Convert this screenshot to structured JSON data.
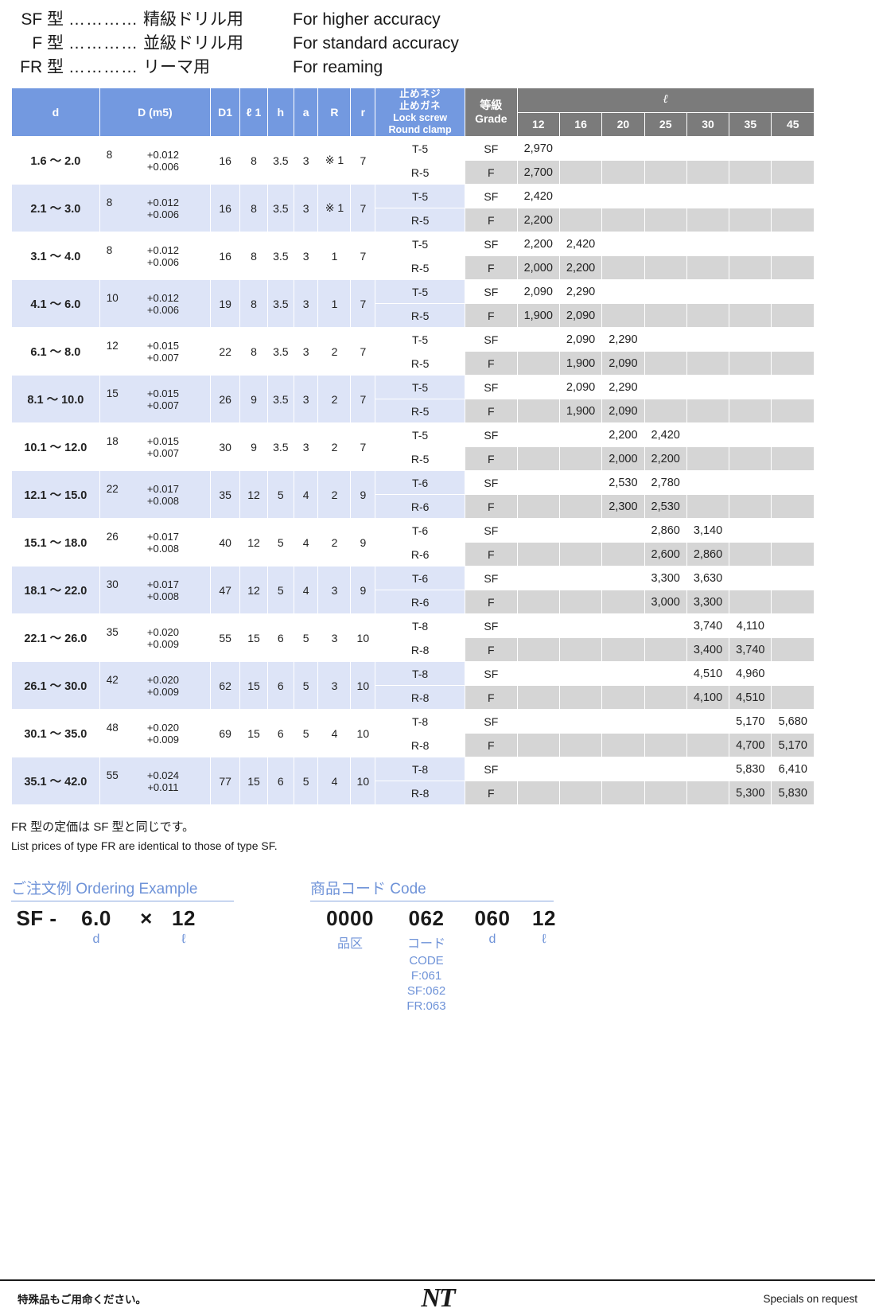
{
  "legend": [
    {
      "type": "SF 型",
      "dots": "…………",
      "jp": "精級ドリル用",
      "en": "For higher accuracy"
    },
    {
      "type": "F 型",
      "dots": "…………",
      "jp": "並級ドリル用",
      "en": "For standard accuracy"
    },
    {
      "type": "FR 型",
      "dots": "…………",
      "jp": "リーマ用",
      "en": "For reaming"
    }
  ],
  "table": {
    "headers": {
      "d": "d",
      "D": "D (m5)",
      "D1": "D1",
      "l1": "ℓ 1",
      "h": "h",
      "a": "a",
      "R": "R",
      "r": "r",
      "lock_jp1": "止めネジ",
      "lock_jp2": "止めガネ",
      "lock_en1": "Lock screw",
      "lock_en2": "Round clamp",
      "grade_jp": "等級",
      "grade_en": "Grade",
      "l_title": "ℓ"
    },
    "l_columns": [
      "12",
      "16",
      "20",
      "25",
      "30",
      "35",
      "45"
    ],
    "rows": [
      {
        "d": "1.6 〜 2.0",
        "D": "8",
        "tol_up": "+0.012",
        "tol_lo": "+0.006",
        "D1": "16",
        "l1": "8",
        "h": "3.5",
        "a": "3",
        "R": "※ 1",
        "r": "7",
        "lock_sf": "T-5",
        "lock_f": "R-5",
        "grade_sf": "SF",
        "grade_f": "F",
        "prices_sf": [
          "2,970",
          "",
          "",
          "",
          "",
          "",
          ""
        ],
        "prices_f": [
          "2,700",
          "",
          "",
          "",
          "",
          "",
          ""
        ]
      },
      {
        "d": "2.1 〜 3.0",
        "D": "8",
        "tol_up": "+0.012",
        "tol_lo": "+0.006",
        "D1": "16",
        "l1": "8",
        "h": "3.5",
        "a": "3",
        "R": "※ 1",
        "r": "7",
        "lock_sf": "T-5",
        "lock_f": "R-5",
        "grade_sf": "SF",
        "grade_f": "F",
        "prices_sf": [
          "2,420",
          "",
          "",
          "",
          "",
          "",
          ""
        ],
        "prices_f": [
          "2,200",
          "",
          "",
          "",
          "",
          "",
          ""
        ]
      },
      {
        "d": "3.1 〜 4.0",
        "D": "8",
        "tol_up": "+0.012",
        "tol_lo": "+0.006",
        "D1": "16",
        "l1": "8",
        "h": "3.5",
        "a": "3",
        "R": "1",
        "r": "7",
        "lock_sf": "T-5",
        "lock_f": "R-5",
        "grade_sf": "SF",
        "grade_f": "F",
        "prices_sf": [
          "2,200",
          "2,420",
          "",
          "",
          "",
          "",
          ""
        ],
        "prices_f": [
          "2,000",
          "2,200",
          "",
          "",
          "",
          "",
          ""
        ]
      },
      {
        "d": "4.1 〜 6.0",
        "D": "10",
        "tol_up": "+0.012",
        "tol_lo": "+0.006",
        "D1": "19",
        "l1": "8",
        "h": "3.5",
        "a": "3",
        "R": "1",
        "r": "7",
        "lock_sf": "T-5",
        "lock_f": "R-5",
        "grade_sf": "SF",
        "grade_f": "F",
        "prices_sf": [
          "2,090",
          "2,290",
          "",
          "",
          "",
          "",
          ""
        ],
        "prices_f": [
          "1,900",
          "2,090",
          "",
          "",
          "",
          "",
          ""
        ]
      },
      {
        "d": "6.1 〜 8.0",
        "D": "12",
        "tol_up": "+0.015",
        "tol_lo": "+0.007",
        "D1": "22",
        "l1": "8",
        "h": "3.5",
        "a": "3",
        "R": "2",
        "r": "7",
        "lock_sf": "T-5",
        "lock_f": "R-5",
        "grade_sf": "SF",
        "grade_f": "F",
        "prices_sf": [
          "",
          "2,090",
          "2,290",
          "",
          "",
          "",
          ""
        ],
        "prices_f": [
          "",
          "1,900",
          "2,090",
          "",
          "",
          "",
          ""
        ]
      },
      {
        "d": "8.1 〜 10.0",
        "D": "15",
        "tol_up": "+0.015",
        "tol_lo": "+0.007",
        "D1": "26",
        "l1": "9",
        "h": "3.5",
        "a": "3",
        "R": "2",
        "r": "7",
        "lock_sf": "T-5",
        "lock_f": "R-5",
        "grade_sf": "SF",
        "grade_f": "F",
        "prices_sf": [
          "",
          "2,090",
          "2,290",
          "",
          "",
          "",
          ""
        ],
        "prices_f": [
          "",
          "1,900",
          "2,090",
          "",
          "",
          "",
          ""
        ]
      },
      {
        "d": "10.1 〜 12.0",
        "D": "18",
        "tol_up": "+0.015",
        "tol_lo": "+0.007",
        "D1": "30",
        "l1": "9",
        "h": "3.5",
        "a": "3",
        "R": "2",
        "r": "7",
        "lock_sf": "T-5",
        "lock_f": "R-5",
        "grade_sf": "SF",
        "grade_f": "F",
        "prices_sf": [
          "",
          "",
          "2,200",
          "2,420",
          "",
          "",
          ""
        ],
        "prices_f": [
          "",
          "",
          "2,000",
          "2,200",
          "",
          "",
          ""
        ]
      },
      {
        "d": "12.1 〜 15.0",
        "D": "22",
        "tol_up": "+0.017",
        "tol_lo": "+0.008",
        "D1": "35",
        "l1": "12",
        "h": "5",
        "a": "4",
        "R": "2",
        "r": "9",
        "lock_sf": "T-6",
        "lock_f": "R-6",
        "grade_sf": "SF",
        "grade_f": "F",
        "prices_sf": [
          "",
          "",
          "2,530",
          "2,780",
          "",
          "",
          ""
        ],
        "prices_f": [
          "",
          "",
          "2,300",
          "2,530",
          "",
          "",
          ""
        ]
      },
      {
        "d": "15.1 〜 18.0",
        "D": "26",
        "tol_up": "+0.017",
        "tol_lo": "+0.008",
        "D1": "40",
        "l1": "12",
        "h": "5",
        "a": "4",
        "R": "2",
        "r": "9",
        "lock_sf": "T-6",
        "lock_f": "R-6",
        "grade_sf": "SF",
        "grade_f": "F",
        "prices_sf": [
          "",
          "",
          "",
          "2,860",
          "3,140",
          "",
          ""
        ],
        "prices_f": [
          "",
          "",
          "",
          "2,600",
          "2,860",
          "",
          ""
        ]
      },
      {
        "d": "18.1 〜 22.0",
        "D": "30",
        "tol_up": "+0.017",
        "tol_lo": "+0.008",
        "D1": "47",
        "l1": "12",
        "h": "5",
        "a": "4",
        "R": "3",
        "r": "9",
        "lock_sf": "T-6",
        "lock_f": "R-6",
        "grade_sf": "SF",
        "grade_f": "F",
        "prices_sf": [
          "",
          "",
          "",
          "3,300",
          "3,630",
          "",
          ""
        ],
        "prices_f": [
          "",
          "",
          "",
          "3,000",
          "3,300",
          "",
          ""
        ]
      },
      {
        "d": "22.1 〜 26.0",
        "D": "35",
        "tol_up": "+0.020",
        "tol_lo": "+0.009",
        "D1": "55",
        "l1": "15",
        "h": "6",
        "a": "5",
        "R": "3",
        "r": "10",
        "lock_sf": "T-8",
        "lock_f": "R-8",
        "grade_sf": "SF",
        "grade_f": "F",
        "prices_sf": [
          "",
          "",
          "",
          "",
          "3,740",
          "4,110",
          ""
        ],
        "prices_f": [
          "",
          "",
          "",
          "",
          "3,400",
          "3,740",
          ""
        ]
      },
      {
        "d": "26.1 〜 30.0",
        "D": "42",
        "tol_up": "+0.020",
        "tol_lo": "+0.009",
        "D1": "62",
        "l1": "15",
        "h": "6",
        "a": "5",
        "R": "3",
        "r": "10",
        "lock_sf": "T-8",
        "lock_f": "R-8",
        "grade_sf": "SF",
        "grade_f": "F",
        "prices_sf": [
          "",
          "",
          "",
          "",
          "4,510",
          "4,960",
          ""
        ],
        "prices_f": [
          "",
          "",
          "",
          "",
          "4,100",
          "4,510",
          ""
        ]
      },
      {
        "d": "30.1 〜 35.0",
        "D": "48",
        "tol_up": "+0.020",
        "tol_lo": "+0.009",
        "D1": "69",
        "l1": "15",
        "h": "6",
        "a": "5",
        "R": "4",
        "r": "10",
        "lock_sf": "T-8",
        "lock_f": "R-8",
        "grade_sf": "SF",
        "grade_f": "F",
        "prices_sf": [
          "",
          "",
          "",
          "",
          "",
          "5,170",
          "5,680"
        ],
        "prices_f": [
          "",
          "",
          "",
          "",
          "",
          "4,700",
          "5,170"
        ]
      },
      {
        "d": "35.1 〜 42.0",
        "D": "55",
        "tol_up": "+0.024",
        "tol_lo": "+0.011",
        "D1": "77",
        "l1": "15",
        "h": "6",
        "a": "5",
        "R": "4",
        "r": "10",
        "lock_sf": "T-8",
        "lock_f": "R-8",
        "grade_sf": "SF",
        "grade_f": "F",
        "prices_sf": [
          "",
          "",
          "",
          "",
          "",
          "5,830",
          "6,410"
        ],
        "prices_f": [
          "",
          "",
          "",
          "",
          "",
          "5,300",
          "5,830"
        ]
      }
    ]
  },
  "notes": {
    "jp": "FR 型の定価は SF 型と同じです。",
    "en": "List prices of type FR are identical to those of type SF."
  },
  "ordering": {
    "title": "ご注文例 Ordering Example",
    "code_parts": [
      "SF -",
      "6.0",
      "×",
      "12"
    ],
    "labels": [
      "",
      "d",
      "",
      "ℓ"
    ]
  },
  "product_code": {
    "title": "商品コード Code",
    "code_parts": [
      "0000",
      "062",
      "060",
      "12"
    ],
    "labels": [
      "品区",
      "コード",
      "d",
      "ℓ"
    ],
    "sub_lines": [
      "CODE",
      "F:061",
      "SF:062",
      "FR:063"
    ]
  },
  "footer": {
    "left": "特殊品もご用命ください。",
    "logo": "NT",
    "right": "Specials on request"
  },
  "colors": {
    "header_blue": "#7399e0",
    "header_grey": "#7b7b7b",
    "row_alt": "#dde4f7",
    "price_grey": "#d5d5d5",
    "accent_blue": "#6f93d8"
  }
}
